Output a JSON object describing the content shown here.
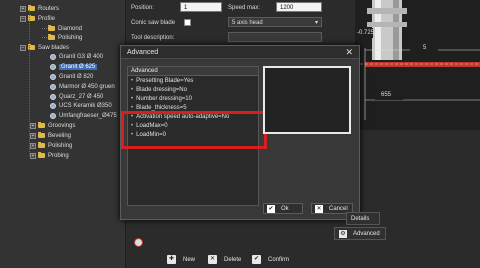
{
  "tree": {
    "items": [
      {
        "label": "Routers",
        "kind": "folder",
        "indent": 1
      },
      {
        "label": "Profile",
        "kind": "folder",
        "indent": 1
      },
      {
        "label": "Diamond",
        "kind": "folder",
        "indent": 2
      },
      {
        "label": "Polishing",
        "kind": "folder",
        "indent": 2
      },
      {
        "label": "Saw blades",
        "kind": "folder",
        "indent": 1
      },
      {
        "label": "Granit G3 Ø 400",
        "kind": "blade",
        "indent": 2
      },
      {
        "label": "Granit Ø 625",
        "kind": "blade",
        "indent": 2,
        "selected": true
      },
      {
        "label": "Granit Ø 820",
        "kind": "blade",
        "indent": 2
      },
      {
        "label": "Marmor Ø 450 gruen",
        "kind": "blade",
        "indent": 2
      },
      {
        "label": "Quarz_27 Ø 450",
        "kind": "blade",
        "indent": 2
      },
      {
        "label": "UCS Keramik Ø350",
        "kind": "blade",
        "indent": 2
      },
      {
        "label": "Umfangfraeser_Ø475",
        "kind": "blade",
        "indent": 2
      },
      {
        "label": "Groovings",
        "kind": "folder",
        "indent": 1
      },
      {
        "label": "Beveling",
        "kind": "folder",
        "indent": 1
      },
      {
        "label": "Polishing",
        "kind": "folder",
        "indent": 1
      },
      {
        "label": "Probing",
        "kind": "folder",
        "indent": 1
      }
    ]
  },
  "form": {
    "position_label": "Position:",
    "position_value": "1",
    "speed_max_label": "Speed max:",
    "speed_max_value": "1200",
    "conic_label": "Conic saw blade",
    "head_value": "5 axis head",
    "tool_desc_label": "Tool description:"
  },
  "drawing": {
    "dim_top": "-0.725",
    "dim_right": "5",
    "dim_bottom": "655"
  },
  "dialog": {
    "title": "Advanced",
    "close": "✕",
    "list_header": "Advanced",
    "rows": [
      "Presetting Blade=Yes",
      "Blade dressing=No",
      "Number dressing=10",
      "Blade_thickness=5",
      "Activation speed auto-adaptive=No",
      "LoadMax=0",
      "LoadMin=0"
    ],
    "ok_label": "Ok",
    "cancel_label": "Cancel"
  },
  "toolbar": {
    "new_label": "New",
    "delete_label": "Delete",
    "confirm_label": "Confirm",
    "details_label": "Details",
    "advanced_label": "Advanced"
  },
  "colors": {
    "selection": "#3d6fb0",
    "highlight_box": "#d81e1e",
    "drawing_red": "#c0392b"
  }
}
